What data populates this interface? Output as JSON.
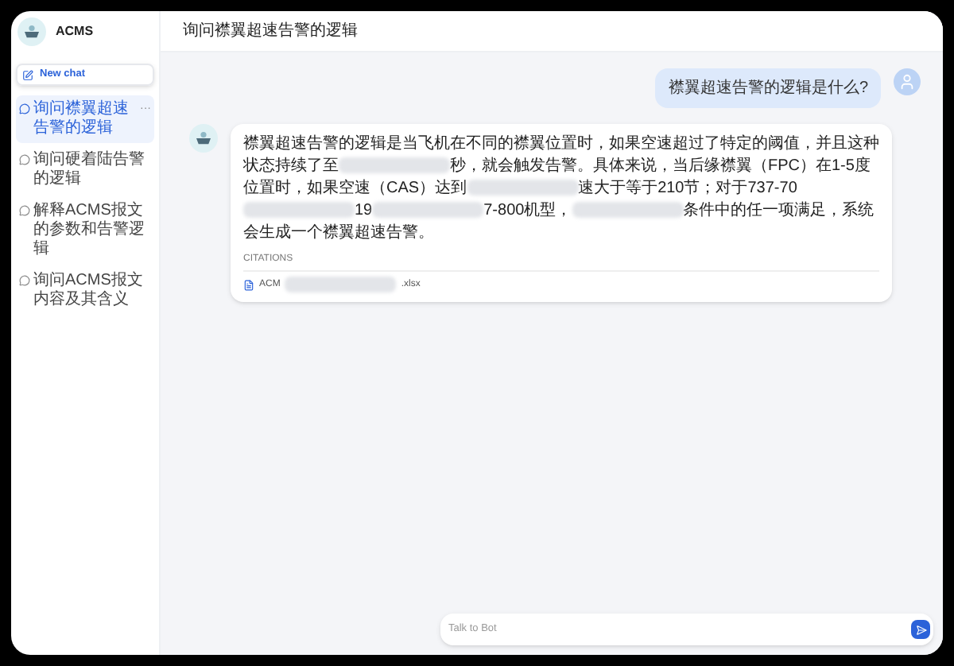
{
  "app": {
    "name": "ACMS"
  },
  "sidebar": {
    "new_chat": "New chat",
    "items": [
      {
        "label": "询问襟翼超速告警的逻辑",
        "selected": true,
        "more": "···"
      },
      {
        "label": "询问硬着陆告警的逻辑",
        "selected": false
      },
      {
        "label": "解释ACMS报文的参数和告警逻辑",
        "selected": false
      },
      {
        "label": "询问ACMS报文内容及其含义",
        "selected": false
      }
    ]
  },
  "chat": {
    "title": "询问襟翼超速告警的逻辑",
    "messages": [
      {
        "kind": "user",
        "segments": [
          {
            "kind": "text",
            "text": "襟翼超速告警的逻辑是什么?"
          }
        ]
      },
      {
        "kind": "bot",
        "segments": [
          {
            "kind": "text",
            "text": "襟翼超速告警的逻辑是当飞机在不同的襟翼位置时，如果空速超过了特定的阈值，并且这种状态持续了至"
          },
          {
            "kind": "redacted"
          },
          {
            "kind": "text",
            "text": "秒，就会触发告警。具体来说，当后缘襟翼（FPC）在1-5度位置时，如果空速（CAS）达到"
          },
          {
            "kind": "redacted"
          },
          {
            "kind": "text",
            "text": "速大于等于210节；对于737-70"
          },
          {
            "kind": "redacted"
          },
          {
            "kind": "text",
            "text": "19"
          },
          {
            "kind": "redacted"
          },
          {
            "kind": "text",
            "text": "7-800机型，"
          },
          {
            "kind": "redacted"
          },
          {
            "kind": "text",
            "text": "条件中的任一项满足，系统会生成一个襟翼超速告警。"
          }
        ],
        "citations_label": "CITATIONS",
        "citations": [
          {
            "segments": [
              {
                "kind": "text",
                "text": "ACM"
              },
              {
                "kind": "redacted"
              },
              {
                "kind": "text",
                "text": ".xlsx"
              }
            ]
          }
        ]
      }
    ]
  },
  "composer": {
    "placeholder": "Talk to Bot"
  }
}
